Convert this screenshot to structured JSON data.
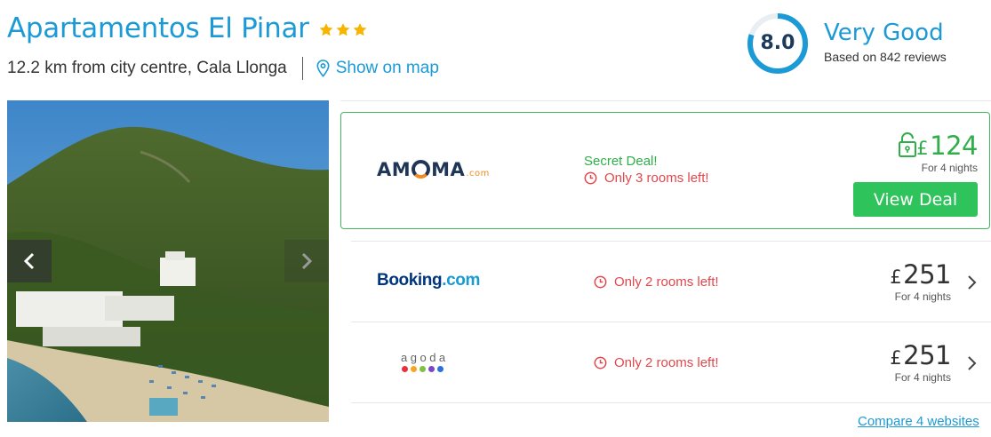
{
  "hotel": {
    "name": "Apartamentos El Pinar",
    "star_rating": 3,
    "location": "12.2 km from city centre, Cala Llonga",
    "map_link_label": "Show on map"
  },
  "rating": {
    "score": "8.0",
    "label": "Very Good",
    "reviews": "Based on 842 reviews"
  },
  "colors": {
    "brand_blue": "#1b9ad6",
    "deal_green": "#2fc35c",
    "alert_red": "#e2474b"
  },
  "deals": [
    {
      "provider": "AMOMA.com",
      "logo_main": "AM",
      "logo_tail": "MA",
      "logo_suffix": ".com",
      "tag": "Secret Deal!",
      "availability": "Only 3 rooms left!",
      "currency": "£",
      "price": "124",
      "nights": "For 4 nights",
      "cta": "View Deal",
      "icon": "unlock-icon"
    },
    {
      "provider": "Booking.com",
      "logo_main": "Booking",
      "logo_suffix": ".com",
      "availability": "Only 2 rooms left!",
      "currency": "£",
      "price": "251",
      "nights": "For 4 nights",
      "icon": "chevron-right-icon"
    },
    {
      "provider": "agoda",
      "logo_main": "agoda",
      "availability": "Only 2 rooms left!",
      "currency": "£",
      "price": "251",
      "nights": "For 4 nights",
      "icon": "chevron-right-icon"
    }
  ],
  "compare_link": "Compare 4 websites"
}
